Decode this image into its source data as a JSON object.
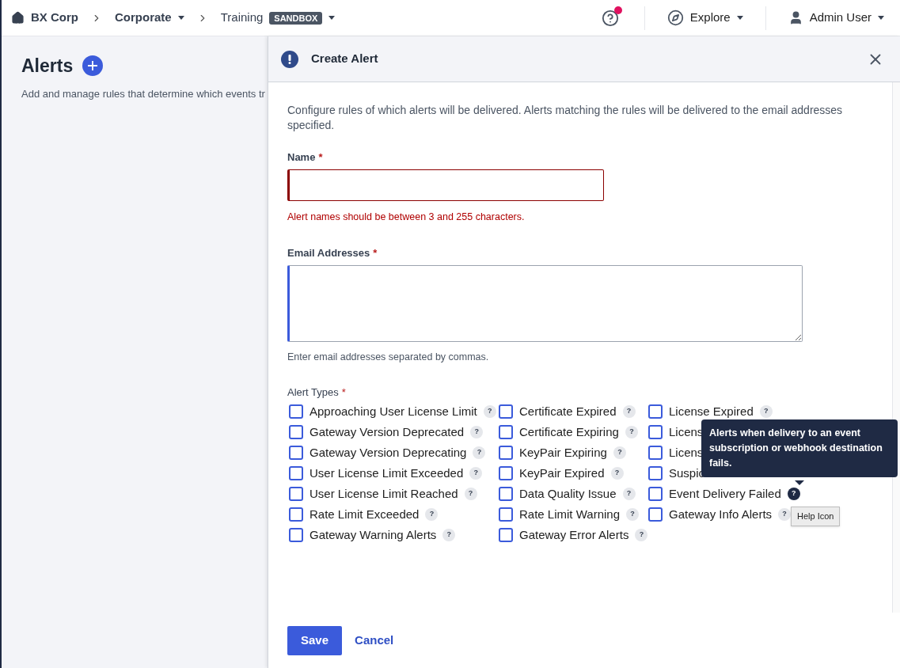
{
  "nav": {
    "breadcrumbs": [
      {
        "label": "BX Corp",
        "dropdown": false
      },
      {
        "label": "Corporate",
        "dropdown": true
      },
      {
        "label": "Training",
        "badge": "SANDBOX",
        "dropdown": true
      }
    ],
    "help_notification": true,
    "explore": "Explore",
    "user": "Admin User"
  },
  "page": {
    "title": "Alerts",
    "description": "Add and manage rules that determine which events tr"
  },
  "panel": {
    "title": "Create Alert",
    "intro": "Configure rules of which alerts will be delivered. Alerts matching the rules will be delivered to the email addresses specified.",
    "name_field": {
      "label": "Name",
      "required_mark": "*",
      "invalid": true,
      "error": "Alert names should be between 3 and 255 characters."
    },
    "email_field": {
      "label": "Email Addresses",
      "required_mark": "*",
      "focused": true,
      "hint": "Enter email addresses separated by commas."
    },
    "alert_types": {
      "label": "Alert Types",
      "required_mark": "*",
      "columns": [
        [
          {
            "label": "Approaching User License Limit",
            "checked": false,
            "help_icon": "?",
            "help_active": false
          },
          {
            "label": "Gateway Version Deprecated",
            "checked": false,
            "help_icon": "?",
            "help_active": false
          },
          {
            "label": "Gateway Version Deprecating",
            "checked": false,
            "help_icon": "?",
            "help_active": false
          },
          {
            "label": "User License Limit Exceeded",
            "checked": false,
            "help_icon": "?",
            "help_active": false
          },
          {
            "label": "User License Limit Reached",
            "checked": false,
            "help_icon": "?",
            "help_active": false
          },
          {
            "label": "Rate Limit Exceeded",
            "checked": false,
            "help_icon": "?",
            "help_active": false
          },
          {
            "label": "Gateway Warning Alerts",
            "checked": false,
            "help_icon": "?",
            "help_active": false
          }
        ],
        [
          {
            "label": "Certificate Expired",
            "checked": false,
            "help_icon": "?",
            "help_active": false
          },
          {
            "label": "Certificate Expiring",
            "checked": false,
            "help_icon": "?",
            "help_active": false
          },
          {
            "label": "KeyPair Expiring",
            "checked": false,
            "help_icon": "?",
            "help_active": false
          },
          {
            "label": "KeyPair Expired",
            "checked": false,
            "help_icon": "?",
            "help_active": false
          },
          {
            "label": "Data Quality Issue",
            "checked": false,
            "help_icon": "?",
            "help_active": false
          },
          {
            "label": "Rate Limit Warning",
            "checked": false,
            "help_icon": "?",
            "help_active": false
          },
          {
            "label": "Gateway Error Alerts",
            "checked": false,
            "help_icon": "?",
            "help_active": false
          }
        ],
        [
          {
            "label": "License Expired",
            "checked": false,
            "help_icon": "?",
            "help_active": false
          },
          {
            "label": "Licens",
            "checked": false
          },
          {
            "label": "Licens",
            "checked": false
          },
          {
            "label": "Suspic",
            "checked": false
          },
          {
            "label": "Event Delivery Failed",
            "checked": false,
            "help_icon": "?",
            "help_active": true
          },
          {
            "label": "Gateway Info Alerts",
            "checked": false,
            "help_icon": "?",
            "help_active": false
          }
        ]
      ]
    },
    "tooltip": "Alerts when delivery to an event subscription or webhook destination fails.",
    "hover_label": "Help Icon",
    "save": "Save",
    "cancel": "Cancel"
  }
}
